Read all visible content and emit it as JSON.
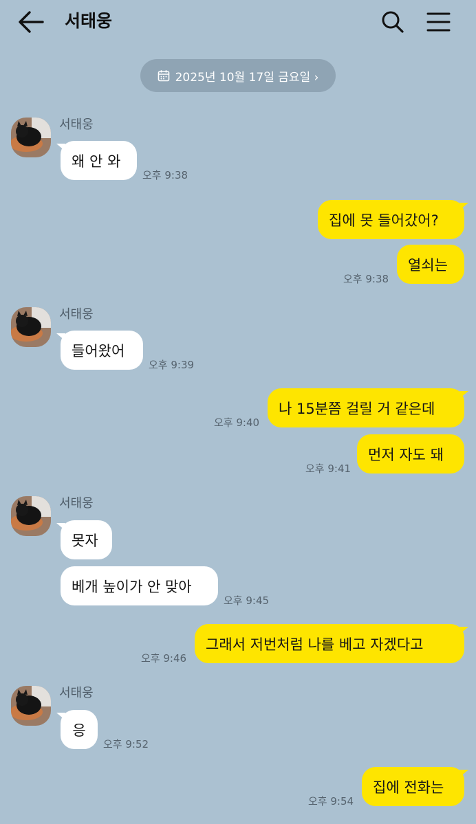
{
  "header": {
    "title": "서태웅",
    "back_icon": "arrow-left-icon",
    "search_icon": "search-icon",
    "menu_icon": "menu-icon"
  },
  "date_pill": {
    "label": "2025년 10월 17일 금요일 ›",
    "icon": "calendar-icon"
  },
  "contact": {
    "name": "서태웅",
    "avatar_icon": "cat-avatar"
  },
  "colors": {
    "background": "#abc1d1",
    "incoming_bubble": "#ffffff",
    "outgoing_bubble": "#fee500",
    "date_pill": "#8fa4b4"
  },
  "messages": [
    {
      "sender": "contact",
      "text": "왜 안 와",
      "time": "오후 9:38"
    },
    {
      "sender": "me",
      "text": "집에 못 들어갔어?",
      "time": ""
    },
    {
      "sender": "me",
      "text": "열쇠는",
      "time": "오후 9:38"
    },
    {
      "sender": "contact",
      "text": "들어왔어",
      "time": "오후 9:39"
    },
    {
      "sender": "me",
      "text": "나 15분쯤 걸릴 거 같은데",
      "time": "오후 9:40"
    },
    {
      "sender": "me",
      "text": "먼저 자도 돼",
      "time": "오후 9:41"
    },
    {
      "sender": "contact",
      "text": "못자",
      "time": ""
    },
    {
      "sender": "contact",
      "text": "베개 높이가 안 맞아",
      "time": "오후 9:45"
    },
    {
      "sender": "me",
      "text": "그래서 저번처럼 나를 베고 자겠다고",
      "time": "오후 9:46"
    },
    {
      "sender": "contact",
      "text": "응",
      "time": "오후 9:52"
    },
    {
      "sender": "me",
      "text": "집에 전화는",
      "time": "오후 9:54"
    }
  ]
}
